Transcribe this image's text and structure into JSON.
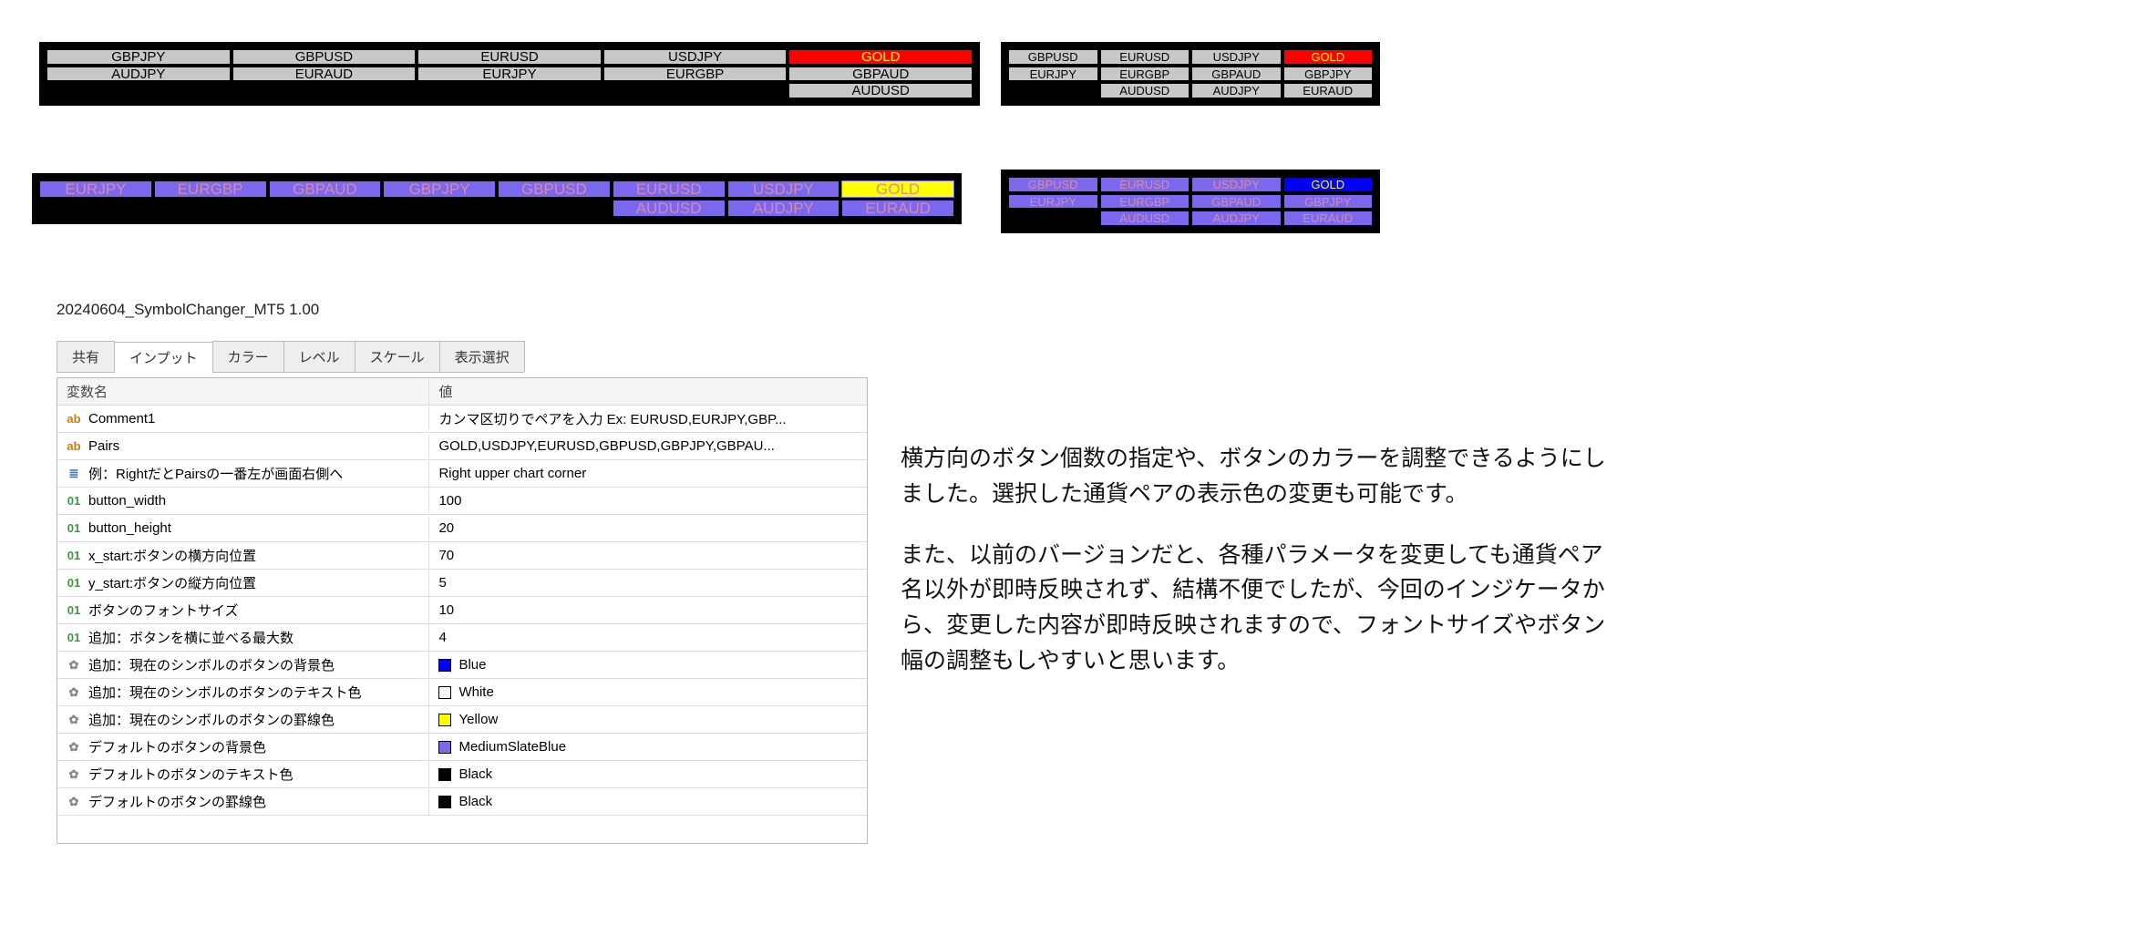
{
  "panel1": {
    "cols": 5,
    "rows": 3,
    "cells": [
      {
        "label": "GBPJPY"
      },
      {
        "label": "GBPUSD"
      },
      {
        "label": "EURUSD"
      },
      {
        "label": "USDJPY"
      },
      {
        "label": "GOLD",
        "selected": true
      },
      {
        "label": "AUDJPY"
      },
      {
        "label": "EURAUD"
      },
      {
        "label": "EURJPY"
      },
      {
        "label": "EURGBP"
      },
      {
        "label": "GBPAUD"
      },
      null,
      null,
      null,
      null,
      {
        "label": "AUDUSD"
      }
    ]
  },
  "panel2": {
    "cols": 4,
    "rows": 3,
    "cells": [
      {
        "label": "GBPUSD"
      },
      {
        "label": "EURUSD"
      },
      {
        "label": "USDJPY"
      },
      {
        "label": "GOLD",
        "selected": true
      },
      {
        "label": "EURJPY"
      },
      {
        "label": "EURGBP"
      },
      {
        "label": "GBPAUD"
      },
      {
        "label": "GBPJPY"
      },
      null,
      {
        "label": "AUDUSD"
      },
      {
        "label": "AUDJPY"
      },
      {
        "label": "EURAUD"
      }
    ]
  },
  "panel3": {
    "cols": 8,
    "rows": 2,
    "cells": [
      {
        "label": "EURJPY"
      },
      {
        "label": "EURGBP"
      },
      {
        "label": "GBPAUD"
      },
      {
        "label": "GBPJPY"
      },
      {
        "label": "GBPUSD"
      },
      {
        "label": "EURUSD"
      },
      {
        "label": "USDJPY"
      },
      {
        "label": "GOLD",
        "selected": true
      },
      null,
      null,
      null,
      null,
      null,
      {
        "label": "AUDUSD"
      },
      {
        "label": "AUDJPY"
      },
      {
        "label": "EURAUD"
      }
    ]
  },
  "panel4": {
    "cols": 4,
    "rows": 3,
    "cells": [
      {
        "label": "GBPUSD"
      },
      {
        "label": "EURUSD"
      },
      {
        "label": "USDJPY"
      },
      {
        "label": "GOLD",
        "selected": true
      },
      {
        "label": "EURJPY"
      },
      {
        "label": "EURGBP"
      },
      {
        "label": "GBPAUD"
      },
      {
        "label": "GBPJPY"
      },
      null,
      {
        "label": "AUDUSD"
      },
      {
        "label": "AUDJPY"
      },
      {
        "label": "EURAUD"
      }
    ]
  },
  "settings": {
    "title": "20240604_SymbolChanger_MT5 1.00",
    "tabs": [
      "共有",
      "インプット",
      "カラー",
      "レベル",
      "スケール",
      "表示選択"
    ],
    "active_tab": 1,
    "headers": {
      "name": "変数名",
      "value": "値"
    },
    "rows": [
      {
        "type": "str",
        "name": "Comment1",
        "value": "カンマ区切りでペアを入力 Ex: EURUSD,EURJPY,GBP..."
      },
      {
        "type": "str",
        "name": "Pairs",
        "value": "GOLD,USDJPY,EURUSD,GBPUSD,GBPJPY,GBPAU..."
      },
      {
        "type": "sel",
        "name": "例：RightだとPairsの一番左が画面右側へ",
        "value": "Right upper chart corner"
      },
      {
        "type": "num",
        "name": "button_width",
        "value": "100"
      },
      {
        "type": "num",
        "name": "button_height",
        "value": "20"
      },
      {
        "type": "num",
        "name": "x_start:ボタンの横方向位置",
        "value": "70"
      },
      {
        "type": "num",
        "name": "y_start:ボタンの縦方向位置",
        "value": "5"
      },
      {
        "type": "num",
        "name": "ボタンのフォントサイズ",
        "value": "10"
      },
      {
        "type": "num",
        "name": "追加：ボタンを横に並べる最大数",
        "value": "4"
      },
      {
        "type": "col",
        "name": "追加：現在のシンボルのボタンの背景色",
        "value": "Blue",
        "swatch": "#0000ff"
      },
      {
        "type": "col",
        "name": "追加：現在のシンボルのボタンのテキスト色",
        "value": "White",
        "swatch": "#ffffff"
      },
      {
        "type": "col",
        "name": "追加：現在のシンボルのボタンの罫線色",
        "value": "Yellow",
        "swatch": "#ffff00"
      },
      {
        "type": "col",
        "name": "デフォルトのボタンの背景色",
        "value": "MediumSlateBlue",
        "swatch": "#7b68ee"
      },
      {
        "type": "col",
        "name": "デフォルトのボタンのテキスト色",
        "value": "Black",
        "swatch": "#000000"
      },
      {
        "type": "col",
        "name": "デフォルトのボタンの罫線色",
        "value": "Black",
        "swatch": "#000000"
      }
    ]
  },
  "desc": {
    "p1": "横方向のボタン個数の指定や、ボタンのカラーを調整できるようにしました。選択した通貨ペアの表示色の変更も可能です。",
    "p2": "また、以前のバージョンだと、各種パラメータを変更しても通貨ペア名以外が即時反映されず、結構不便でしたが、今回のインジケータから、変更した内容が即時反映されますので、フォントサイズやボタン幅の調整もしやすいと思います。"
  }
}
